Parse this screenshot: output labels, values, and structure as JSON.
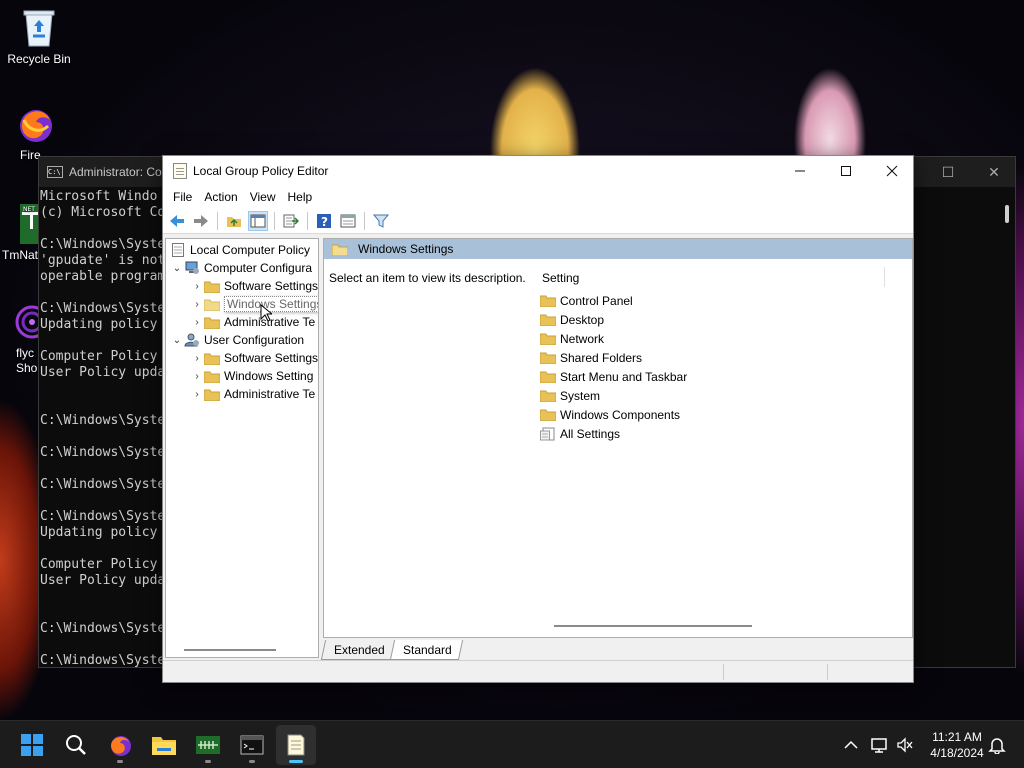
{
  "desktop": {
    "icons": [
      {
        "label": "Recycle Bin",
        "icon": "recycle-bin-icon"
      },
      {
        "label": "Fire",
        "icon": "firefox-icon"
      },
      {
        "label": "TmNat",
        "icon": "app-icon"
      },
      {
        "label": "flyc",
        "label2": "Shor",
        "icon": "swirl-app-icon"
      }
    ]
  },
  "console": {
    "title": "Administrator: Co",
    "lines": [
      "Microsoft Windo",
      "(c) Microsoft Co",
      "",
      "C:\\Windows\\Syste",
      "'gpudate' is not",
      "operable program",
      "",
      "C:\\Windows\\Syste",
      "Updating policy",
      "",
      "Computer Policy",
      "User Policy upda",
      "",
      "",
      "C:\\Windows\\Syste",
      "",
      "C:\\Windows\\Syste",
      "",
      "C:\\Windows\\Syste",
      "",
      "C:\\Windows\\Syste",
      "Updating policy",
      "",
      "Computer Policy",
      "User Policy upda",
      "",
      "",
      "C:\\Windows\\Syste",
      "",
      "C:\\Windows\\Syste"
    ]
  },
  "gpe": {
    "title": "Local Group Policy Editor",
    "menu": [
      "File",
      "Action",
      "View",
      "Help"
    ],
    "tree": [
      {
        "label": "Local Computer Policy",
        "level": 0,
        "chevron": "",
        "icon": "policy"
      },
      {
        "label": "Computer Configura",
        "level": 1,
        "chevron": "⌄",
        "icon": "computer"
      },
      {
        "label": "Software Settings",
        "level": 2,
        "chevron": "›",
        "icon": "folder"
      },
      {
        "label": "Windows Settings",
        "level": 2,
        "chevron": "›",
        "icon": "folder"
      },
      {
        "label": "Administrative Te",
        "level": 2,
        "chevron": "›",
        "icon": "folder"
      },
      {
        "label": "User Configuration",
        "level": 1,
        "chevron": "⌄",
        "icon": "user"
      },
      {
        "label": "Software Settings",
        "level": 2,
        "chevron": "›",
        "icon": "folder"
      },
      {
        "label": "Windows Setting",
        "level": 2,
        "chevron": "›",
        "icon": "folder"
      },
      {
        "label": "Administrative Te",
        "level": 2,
        "chevron": "›",
        "icon": "folder"
      }
    ],
    "right_header": "Windows Settings",
    "description": "Select an item to view its description.",
    "column_header": "Setting",
    "items": [
      {
        "label": "Control Panel",
        "icon": "folder"
      },
      {
        "label": "Desktop",
        "icon": "folder"
      },
      {
        "label": "Network",
        "icon": "folder"
      },
      {
        "label": "Shared Folders",
        "icon": "folder"
      },
      {
        "label": "Start Menu and Taskbar",
        "icon": "folder"
      },
      {
        "label": "System",
        "icon": "folder"
      },
      {
        "label": "Windows Components",
        "icon": "folder"
      },
      {
        "label": "All Settings",
        "icon": "settings-list"
      }
    ],
    "tabs": [
      "Extended",
      "Standard"
    ]
  },
  "taskbar": {
    "time": "11:21 AM",
    "date": "4/18/2024"
  }
}
